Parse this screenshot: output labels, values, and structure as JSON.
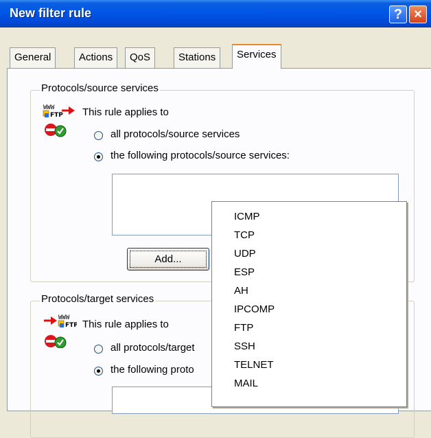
{
  "window": {
    "title": "New filter rule",
    "help_label": "?",
    "close_label": "×"
  },
  "tabs": [
    {
      "label": "General"
    },
    {
      "label": "Actions"
    },
    {
      "label": "QoS"
    },
    {
      "label": "Stations"
    },
    {
      "label": "Services"
    }
  ],
  "active_tab": "Services",
  "source": {
    "group_label": "Protocols/source services",
    "applies_label": "This rule applies to",
    "option_all": "all protocols/source services",
    "option_following": "the following protocols/source services:",
    "add_button": "Add...",
    "icon_www": "WWW",
    "icon_ftp": "FTP"
  },
  "target": {
    "group_label": "Protocols/target services",
    "applies_label": "This rule applies to",
    "option_all": "all protocols/target",
    "option_following": "the following proto",
    "icon_www": "WWW",
    "icon_ftp": "FTP"
  },
  "menu": {
    "items": [
      "ICMP",
      "TCP",
      "UDP",
      "ESP",
      "AH",
      "IPCOMP",
      "FTP",
      "SSH",
      "TELNET",
      "MAIL"
    ]
  },
  "colors": {
    "titlebar": "#0055e5",
    "dialog": "#ece9d8",
    "active_tab_accent": "#e68b2c"
  }
}
